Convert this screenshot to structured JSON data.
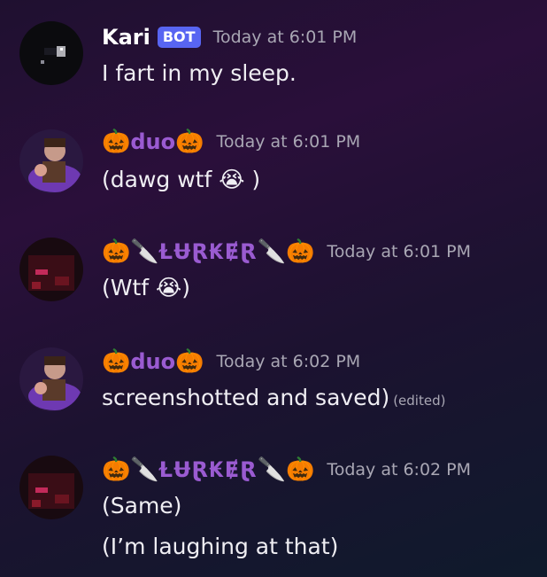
{
  "messages": [
    {
      "username": "Kari",
      "bot_badge": "BOT",
      "timestamp": "Today at 6:01 PM",
      "lines": [
        "I fart in my sleep."
      ]
    },
    {
      "username": "duo",
      "name_prefix_emoji": "🎃",
      "name_suffix_emoji": "🎃",
      "timestamp": "Today at 6:01 PM",
      "lines": [
        "(dawg wtf 😭 )"
      ]
    },
    {
      "username": "ⱢɄⱤ₭ɆⱤ",
      "name_prefix_emoji": "🎃🔪",
      "name_suffix_emoji": "🔪🎃",
      "timestamp": "Today at 6:01 PM",
      "lines": [
        "(Wtf 😭)"
      ]
    },
    {
      "username": "duo",
      "name_prefix_emoji": "🎃",
      "name_suffix_emoji": "🎃",
      "timestamp": "Today at 6:02 PM",
      "lines": [
        "screenshotted and saved)"
      ],
      "edited_label": "(edited)"
    },
    {
      "username": "ⱢɄⱤ₭ɆⱤ",
      "name_prefix_emoji": "🎃🔪",
      "name_suffix_emoji": "🔪🎃",
      "timestamp": "Today at 6:02 PM",
      "lines": [
        "(Same)",
        "(I’m laughing at that)"
      ]
    }
  ],
  "colors": {
    "bot_badge": "#5865f2",
    "role_purple": "#9a5bd1",
    "timestamp": "#a9a7b4"
  }
}
